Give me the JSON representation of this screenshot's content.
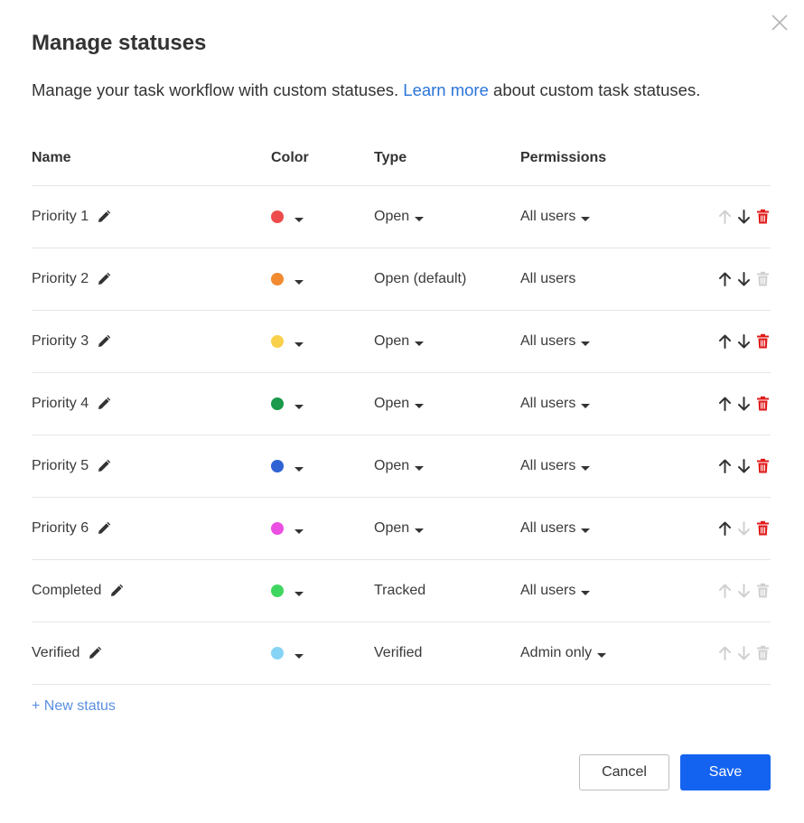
{
  "dialog": {
    "title": "Manage statuses",
    "subtitle_before": "Manage your task workflow with custom statuses. ",
    "learn_more": "Learn more",
    "subtitle_after": " about custom task statuses.",
    "close_icon": "close-x-icon"
  },
  "columns": {
    "name": "Name",
    "color": "Color",
    "type": "Type",
    "permissions": "Permissions"
  },
  "rows": [
    {
      "name": "Priority 1",
      "color": "#ee4c4c",
      "type": "Open",
      "type_dropdown": true,
      "permissions": "All users",
      "perm_dropdown": true,
      "up": false,
      "down": true,
      "del": true
    },
    {
      "name": "Priority 2",
      "color": "#f28a30",
      "type": "Open (default)",
      "type_dropdown": false,
      "permissions": "All users",
      "perm_dropdown": false,
      "up": true,
      "down": true,
      "del": false
    },
    {
      "name": "Priority 3",
      "color": "#f9d04c",
      "type": "Open",
      "type_dropdown": true,
      "permissions": "All users",
      "perm_dropdown": true,
      "up": true,
      "down": true,
      "del": true
    },
    {
      "name": "Priority 4",
      "color": "#1a9a4a",
      "type": "Open",
      "type_dropdown": true,
      "permissions": "All users",
      "perm_dropdown": true,
      "up": true,
      "down": true,
      "del": true
    },
    {
      "name": "Priority 5",
      "color": "#2f63d4",
      "type": "Open",
      "type_dropdown": true,
      "permissions": "All users",
      "perm_dropdown": true,
      "up": true,
      "down": true,
      "del": true
    },
    {
      "name": "Priority 6",
      "color": "#ea4fe2",
      "type": "Open",
      "type_dropdown": true,
      "permissions": "All users",
      "perm_dropdown": true,
      "up": true,
      "down": false,
      "del": true
    },
    {
      "name": "Completed",
      "color": "#3fd65f",
      "type": "Tracked",
      "type_dropdown": false,
      "permissions": "All users",
      "perm_dropdown": true,
      "up": false,
      "down": false,
      "del": false
    },
    {
      "name": "Verified",
      "color": "#86d4f5",
      "type": "Verified",
      "type_dropdown": false,
      "permissions": "Admin only",
      "perm_dropdown": true,
      "up": false,
      "down": false,
      "del": false
    }
  ],
  "new_status": "+ New status",
  "buttons": {
    "cancel": "Cancel",
    "save": "Save"
  },
  "theme": {
    "accent": "#1463f0",
    "link": "#2a74d9",
    "delete_active": "#e01a1a",
    "icon_active": "#333333",
    "icon_disabled": "#d0d0d0"
  }
}
